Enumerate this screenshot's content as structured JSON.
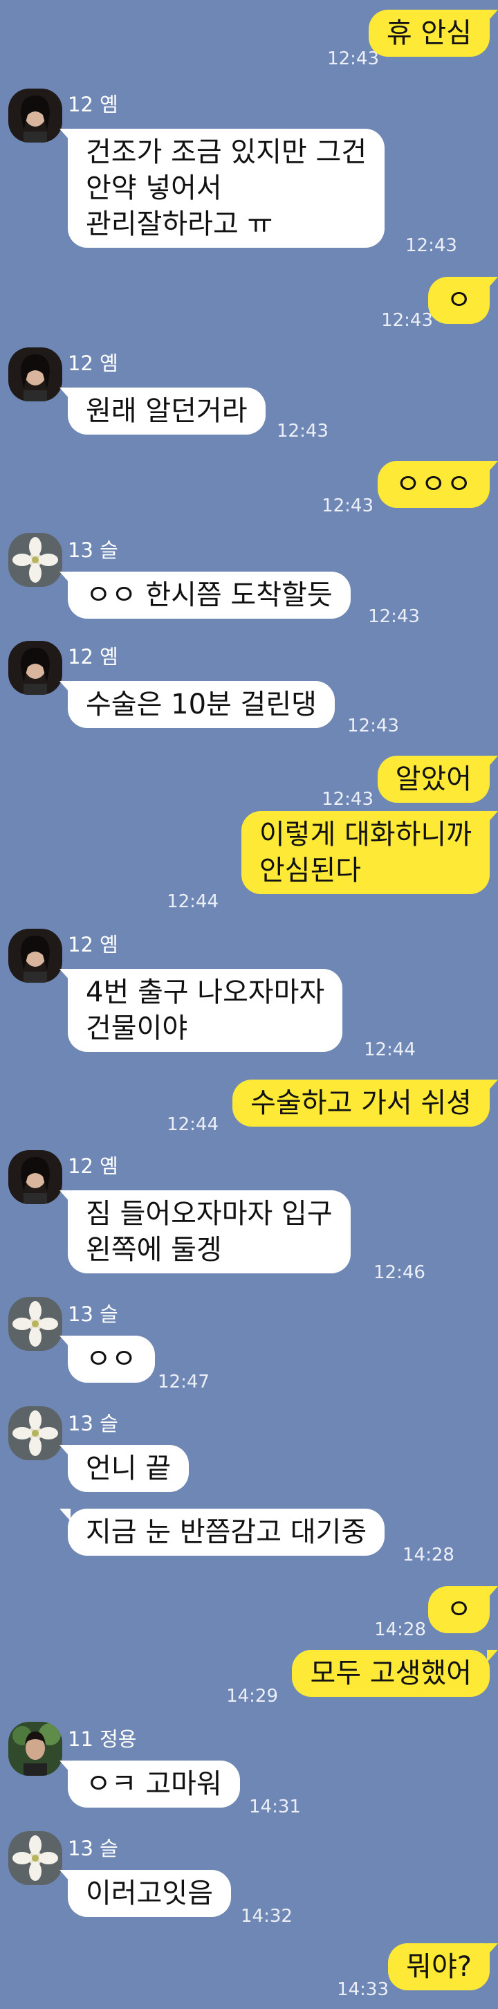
{
  "messages": [
    {
      "sender": "",
      "text": "휴    안심",
      "time": "12:43",
      "mine": true
    },
    {
      "sender": "12 옘",
      "text": "건조가 조금 있지만 그건\n안약 넣어서\n관리잘하라고 ㅠ",
      "time": "12:43",
      "mine": false
    },
    {
      "sender": "",
      "text": "ㅇ",
      "time": "12:43",
      "mine": true
    },
    {
      "sender": "12 옘",
      "text": "원래 알던거라",
      "time": "12:43",
      "mine": false
    },
    {
      "sender": "",
      "text": "ㅇㅇㅇ",
      "time": "12:43",
      "mine": true
    },
    {
      "sender": "13 슬",
      "text": "ㅇㅇ 한시쯤 도착할듯",
      "time": "12:43",
      "mine": false
    },
    {
      "sender": "12 옘",
      "text": "수술은 10분 걸린댕",
      "time": "12:43",
      "mine": false
    },
    {
      "sender": "",
      "text": "알았어",
      "time": "12:43",
      "mine": true
    },
    {
      "sender": "",
      "text": "이렇게 대화하니까\n안심된다",
      "time": "12:44",
      "mine": true
    },
    {
      "sender": "12 옘",
      "text": "4번 출구 나오자마자\n건물이야",
      "time": "12:44",
      "mine": false
    },
    {
      "sender": "",
      "text": "수술하고 가서 쉬셩",
      "time": "12:44",
      "mine": true
    },
    {
      "sender": "12 옘",
      "text": "짐 들어오자마자 입구\n왼쪽에 둘겡",
      "time": "12:46",
      "mine": false
    },
    {
      "sender": "13 슬",
      "text": "ㅇㅇ",
      "time": "12:47",
      "mine": false
    },
    {
      "sender": "13 슬",
      "text": "언니 끝",
      "time": "",
      "mine": false
    },
    {
      "sender": "",
      "text": "지금 눈 반쯤감고 대기중",
      "time": "14:28",
      "mine": false
    },
    {
      "sender": "",
      "text": "ㅇ",
      "time": "14:28",
      "mine": true
    },
    {
      "sender": "",
      "text": "모두 고생했어",
      "time": "14:29",
      "mine": true
    },
    {
      "sender": "11 정용",
      "text": "ㅇㅋ 고마워",
      "time": "14:31",
      "mine": false
    },
    {
      "sender": "13 슬",
      "text": "이러고잇음",
      "time": "14:32",
      "mine": false
    },
    {
      "sender": "",
      "text": "뭐야?",
      "time": "14:33",
      "mine": true
    }
  ]
}
